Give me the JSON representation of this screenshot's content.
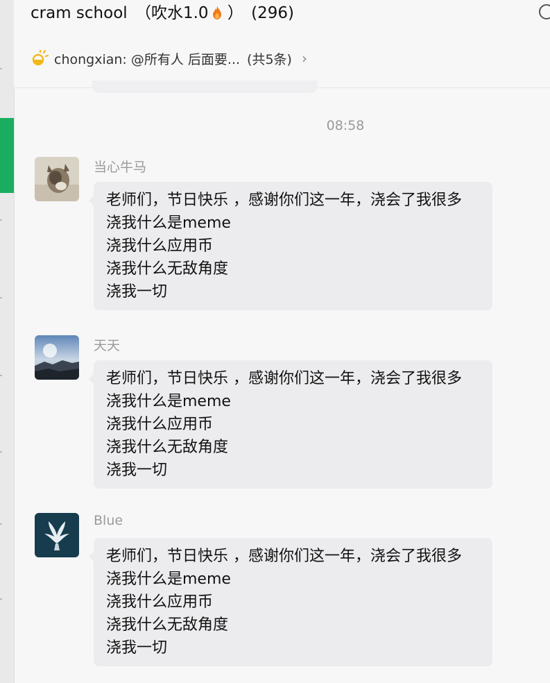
{
  "chat": {
    "name": "cram school",
    "group_tag": "（吹水1.0",
    "group_tag_close": "）",
    "member_count": "(296)"
  },
  "notice": {
    "text": "chongxian: @所有人 后面要...",
    "count": "(共5条)",
    "chevron": "›"
  },
  "timestamp": "08:58",
  "messages": [
    {
      "sender": "当心牛马",
      "lines": [
        "老师们，节日快乐 ，感谢你们这一年，浇会了我很多",
        "浇我什么是meme",
        "浇我什么应用币",
        "浇我什么无敌角度",
        "浇我一切"
      ]
    },
    {
      "sender": "天天",
      "lines": [
        "老师们，节日快乐 ，感谢你们这一年，浇会了我很多",
        "浇我什么是meme",
        "浇我什么应用币",
        "浇我什么无敌角度",
        "浇我一切"
      ]
    },
    {
      "sender": "Blue",
      "lines": [
        "老师们，节日快乐 ，感谢你们这一年，浇会了我很多",
        "浇我什么是meme",
        "浇我什么应用币",
        "浇我什么无敌角度",
        "浇我一切"
      ]
    }
  ],
  "colors": {
    "active_nav": "#1aad5f",
    "bubble": "#ececee",
    "background": "#f7f7f7",
    "muted_text": "#9a9a9a"
  },
  "icons": {
    "fire": "fire-icon",
    "announcement": "sun-icon",
    "more": "more-icon"
  }
}
